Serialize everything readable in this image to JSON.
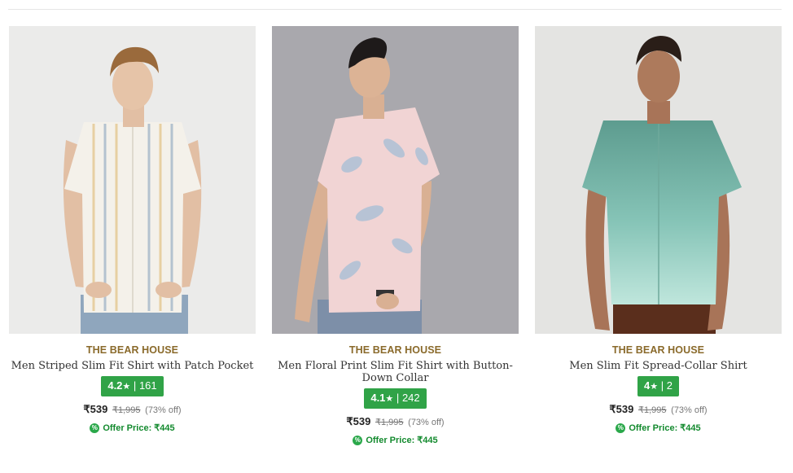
{
  "products": [
    {
      "brand": "THE BEAR HOUSE",
      "title": "Men Striped Slim Fit Shirt with Patch Pocket",
      "rating": "4.2",
      "rating_star": "★",
      "rating_sep": "|",
      "reviews": "161",
      "price": "₹539",
      "mrp": "₹1,995",
      "discount": "(73% off)",
      "offer_label": "Offer Price: ₹445",
      "image_desc_icon": "model-photo-striped-shirt"
    },
    {
      "brand": "THE BEAR HOUSE",
      "title": "Men Floral Print Slim Fit Shirt with Button-Down Collar",
      "rating": "4.1",
      "rating_star": "★",
      "rating_sep": "|",
      "reviews": "242",
      "price": "₹539",
      "mrp": "₹1,995",
      "discount": "(73% off)",
      "offer_label": "Offer Price: ₹445",
      "image_desc_icon": "model-photo-floral-shirt"
    },
    {
      "brand": "THE BEAR HOUSE",
      "title": "Men Slim Fit Spread-Collar Shirt",
      "rating": "4",
      "rating_star": "★",
      "rating_sep": "|",
      "reviews": "2",
      "price": "₹539",
      "mrp": "₹1,995",
      "discount": "(73% off)",
      "offer_label": "Offer Price: ₹445",
      "image_desc_icon": "model-photo-green-shirt"
    }
  ],
  "colors": {
    "brand": "#8a6a2b",
    "rating_bg": "#30a347",
    "offer": "#138a2e"
  }
}
